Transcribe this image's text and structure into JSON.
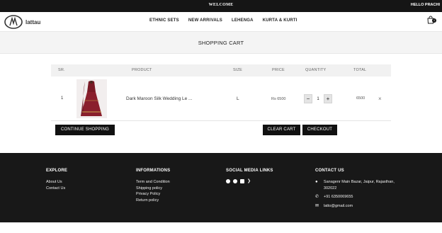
{
  "topbar": {
    "welcome": "WELCOME",
    "greeting": "HELLO PRACHI"
  },
  "brand": {
    "name": "lattau"
  },
  "nav": {
    "items": [
      "ETHNIC SETS",
      "NEW ARRIVALS",
      "LEHENGA",
      "KURTA & KURTI"
    ]
  },
  "cart": {
    "count": "1"
  },
  "page": {
    "title": "SHOPPING CART"
  },
  "table": {
    "headers": {
      "sr": "SR.",
      "product": "PRODUCT",
      "size": "SIZE",
      "price": "PRICE",
      "quantity": "QUANTITY",
      "total": "TOTAL"
    },
    "rows": [
      {
        "sr": "1",
        "product": "Dark Maroon Silk Wedding Le ...",
        "size": "L",
        "price": "Rs 6500",
        "quantity": "1",
        "total": "6500"
      }
    ]
  },
  "actions": {
    "continue": "CONTINUE SHOPPING",
    "clear": "CLEAR CART",
    "checkout": "CHECKOUT",
    "minus": "−",
    "plus": "+",
    "remove": "×"
  },
  "footer": {
    "explore": {
      "title": "EXPLORE",
      "links": [
        "About Us",
        "Contact Us"
      ]
    },
    "info": {
      "title": "INFORMATIONS",
      "links": [
        "Term and Condition",
        "Shipping policy",
        "Privacy Policy",
        "Return policy"
      ]
    },
    "social": {
      "title": "SOCIAL MEDIA LINKS",
      "icons": [
        "facebook-icon",
        "instagram-icon",
        "linkedin-icon",
        "twitter-icon"
      ]
    },
    "contact": {
      "title": "CONTACT US",
      "address": "Sanagenr Main Bazar, Jaipur, Rajasthan, 302022",
      "phone": "+91 6350069655",
      "email": "latto@gmail.com"
    }
  },
  "colors": {
    "dark": "#151515",
    "band": "#f4f4f4",
    "product": "#7a1a26"
  }
}
